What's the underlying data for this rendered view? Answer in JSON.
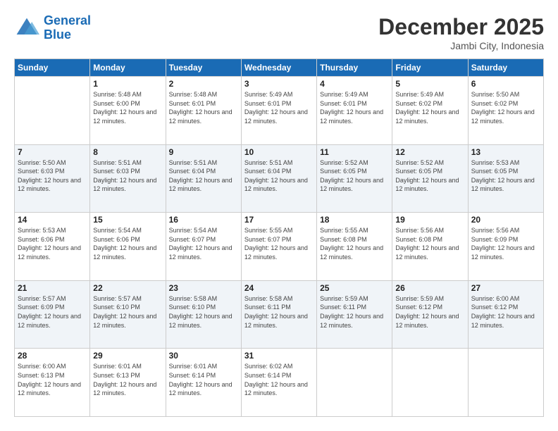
{
  "header": {
    "logo_line1": "General",
    "logo_line2": "Blue",
    "month": "December 2025",
    "location": "Jambi City, Indonesia"
  },
  "days_of_week": [
    "Sunday",
    "Monday",
    "Tuesday",
    "Wednesday",
    "Thursday",
    "Friday",
    "Saturday"
  ],
  "weeks": [
    [
      {
        "num": "",
        "sunrise": "",
        "sunset": "",
        "daylight": ""
      },
      {
        "num": "1",
        "sunrise": "Sunrise: 5:48 AM",
        "sunset": "Sunset: 6:00 PM",
        "daylight": "Daylight: 12 hours and 12 minutes."
      },
      {
        "num": "2",
        "sunrise": "Sunrise: 5:48 AM",
        "sunset": "Sunset: 6:01 PM",
        "daylight": "Daylight: 12 hours and 12 minutes."
      },
      {
        "num": "3",
        "sunrise": "Sunrise: 5:49 AM",
        "sunset": "Sunset: 6:01 PM",
        "daylight": "Daylight: 12 hours and 12 minutes."
      },
      {
        "num": "4",
        "sunrise": "Sunrise: 5:49 AM",
        "sunset": "Sunset: 6:01 PM",
        "daylight": "Daylight: 12 hours and 12 minutes."
      },
      {
        "num": "5",
        "sunrise": "Sunrise: 5:49 AM",
        "sunset": "Sunset: 6:02 PM",
        "daylight": "Daylight: 12 hours and 12 minutes."
      },
      {
        "num": "6",
        "sunrise": "Sunrise: 5:50 AM",
        "sunset": "Sunset: 6:02 PM",
        "daylight": "Daylight: 12 hours and 12 minutes."
      }
    ],
    [
      {
        "num": "7",
        "sunrise": "Sunrise: 5:50 AM",
        "sunset": "Sunset: 6:03 PM",
        "daylight": "Daylight: 12 hours and 12 minutes."
      },
      {
        "num": "8",
        "sunrise": "Sunrise: 5:51 AM",
        "sunset": "Sunset: 6:03 PM",
        "daylight": "Daylight: 12 hours and 12 minutes."
      },
      {
        "num": "9",
        "sunrise": "Sunrise: 5:51 AM",
        "sunset": "Sunset: 6:04 PM",
        "daylight": "Daylight: 12 hours and 12 minutes."
      },
      {
        "num": "10",
        "sunrise": "Sunrise: 5:51 AM",
        "sunset": "Sunset: 6:04 PM",
        "daylight": "Daylight: 12 hours and 12 minutes."
      },
      {
        "num": "11",
        "sunrise": "Sunrise: 5:52 AM",
        "sunset": "Sunset: 6:05 PM",
        "daylight": "Daylight: 12 hours and 12 minutes."
      },
      {
        "num": "12",
        "sunrise": "Sunrise: 5:52 AM",
        "sunset": "Sunset: 6:05 PM",
        "daylight": "Daylight: 12 hours and 12 minutes."
      },
      {
        "num": "13",
        "sunrise": "Sunrise: 5:53 AM",
        "sunset": "Sunset: 6:05 PM",
        "daylight": "Daylight: 12 hours and 12 minutes."
      }
    ],
    [
      {
        "num": "14",
        "sunrise": "Sunrise: 5:53 AM",
        "sunset": "Sunset: 6:06 PM",
        "daylight": "Daylight: 12 hours and 12 minutes."
      },
      {
        "num": "15",
        "sunrise": "Sunrise: 5:54 AM",
        "sunset": "Sunset: 6:06 PM",
        "daylight": "Daylight: 12 hours and 12 minutes."
      },
      {
        "num": "16",
        "sunrise": "Sunrise: 5:54 AM",
        "sunset": "Sunset: 6:07 PM",
        "daylight": "Daylight: 12 hours and 12 minutes."
      },
      {
        "num": "17",
        "sunrise": "Sunrise: 5:55 AM",
        "sunset": "Sunset: 6:07 PM",
        "daylight": "Daylight: 12 hours and 12 minutes."
      },
      {
        "num": "18",
        "sunrise": "Sunrise: 5:55 AM",
        "sunset": "Sunset: 6:08 PM",
        "daylight": "Daylight: 12 hours and 12 minutes."
      },
      {
        "num": "19",
        "sunrise": "Sunrise: 5:56 AM",
        "sunset": "Sunset: 6:08 PM",
        "daylight": "Daylight: 12 hours and 12 minutes."
      },
      {
        "num": "20",
        "sunrise": "Sunrise: 5:56 AM",
        "sunset": "Sunset: 6:09 PM",
        "daylight": "Daylight: 12 hours and 12 minutes."
      }
    ],
    [
      {
        "num": "21",
        "sunrise": "Sunrise: 5:57 AM",
        "sunset": "Sunset: 6:09 PM",
        "daylight": "Daylight: 12 hours and 12 minutes."
      },
      {
        "num": "22",
        "sunrise": "Sunrise: 5:57 AM",
        "sunset": "Sunset: 6:10 PM",
        "daylight": "Daylight: 12 hours and 12 minutes."
      },
      {
        "num": "23",
        "sunrise": "Sunrise: 5:58 AM",
        "sunset": "Sunset: 6:10 PM",
        "daylight": "Daylight: 12 hours and 12 minutes."
      },
      {
        "num": "24",
        "sunrise": "Sunrise: 5:58 AM",
        "sunset": "Sunset: 6:11 PM",
        "daylight": "Daylight: 12 hours and 12 minutes."
      },
      {
        "num": "25",
        "sunrise": "Sunrise: 5:59 AM",
        "sunset": "Sunset: 6:11 PM",
        "daylight": "Daylight: 12 hours and 12 minutes."
      },
      {
        "num": "26",
        "sunrise": "Sunrise: 5:59 AM",
        "sunset": "Sunset: 6:12 PM",
        "daylight": "Daylight: 12 hours and 12 minutes."
      },
      {
        "num": "27",
        "sunrise": "Sunrise: 6:00 AM",
        "sunset": "Sunset: 6:12 PM",
        "daylight": "Daylight: 12 hours and 12 minutes."
      }
    ],
    [
      {
        "num": "28",
        "sunrise": "Sunrise: 6:00 AM",
        "sunset": "Sunset: 6:13 PM",
        "daylight": "Daylight: 12 hours and 12 minutes."
      },
      {
        "num": "29",
        "sunrise": "Sunrise: 6:01 AM",
        "sunset": "Sunset: 6:13 PM",
        "daylight": "Daylight: 12 hours and 12 minutes."
      },
      {
        "num": "30",
        "sunrise": "Sunrise: 6:01 AM",
        "sunset": "Sunset: 6:14 PM",
        "daylight": "Daylight: 12 hours and 12 minutes."
      },
      {
        "num": "31",
        "sunrise": "Sunrise: 6:02 AM",
        "sunset": "Sunset: 6:14 PM",
        "daylight": "Daylight: 12 hours and 12 minutes."
      },
      {
        "num": "",
        "sunrise": "",
        "sunset": "",
        "daylight": ""
      },
      {
        "num": "",
        "sunrise": "",
        "sunset": "",
        "daylight": ""
      },
      {
        "num": "",
        "sunrise": "",
        "sunset": "",
        "daylight": ""
      }
    ]
  ]
}
